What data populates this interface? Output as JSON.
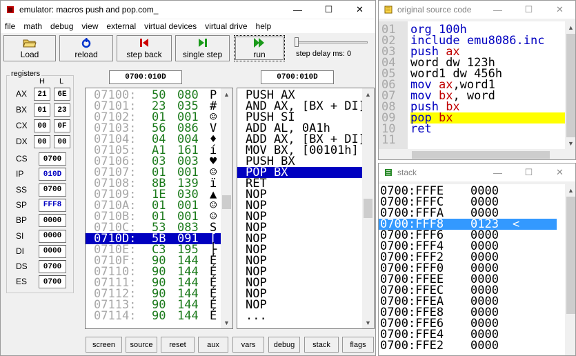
{
  "emulator": {
    "title": "emulator: macros push and pop.com_",
    "menu": [
      "file",
      "math",
      "debug",
      "view",
      "external",
      "virtual devices",
      "virtual drive",
      "help"
    ],
    "toolbar": {
      "load": "Load",
      "reload": "reload",
      "step_back": "step back",
      "single_step": "single step",
      "run": "run",
      "step_delay": "step delay ms: 0"
    },
    "registers_label": "registers",
    "col_h": "H",
    "col_l": "L",
    "gp": [
      {
        "name": "AX",
        "h": "21",
        "l": "6E"
      },
      {
        "name": "BX",
        "h": "01",
        "l": "23"
      },
      {
        "name": "CX",
        "h": "00",
        "l": "0F"
      },
      {
        "name": "DX",
        "h": "00",
        "l": "00"
      }
    ],
    "seg": [
      {
        "name": "CS",
        "value": "0700",
        "highlight": false
      },
      {
        "name": "IP",
        "value": "010D",
        "highlight": true
      },
      {
        "name": "SS",
        "value": "0700",
        "highlight": false
      },
      {
        "name": "SP",
        "value": "FFF8",
        "highlight": true
      },
      {
        "name": "BP",
        "value": "0000",
        "highlight": false
      },
      {
        "name": "SI",
        "value": "0000",
        "highlight": false
      },
      {
        "name": "DI",
        "value": "0000",
        "highlight": false
      },
      {
        "name": "DS",
        "value": "0700",
        "highlight": false
      },
      {
        "name": "ES",
        "value": "0700",
        "highlight": false
      }
    ],
    "mem_address": "0700:010D",
    "dis_address": "0700:010D",
    "memory": [
      {
        "addr": "07100:",
        "hex": "50",
        "dec": "080",
        "ch": "P"
      },
      {
        "addr": "07101:",
        "hex": "23",
        "dec": "035",
        "ch": "#"
      },
      {
        "addr": "07102:",
        "hex": "01",
        "dec": "001",
        "ch": "☺"
      },
      {
        "addr": "07103:",
        "hex": "56",
        "dec": "086",
        "ch": "V"
      },
      {
        "addr": "07104:",
        "hex": "04",
        "dec": "004",
        "ch": "♦"
      },
      {
        "addr": "07105:",
        "hex": "A1",
        "dec": "161",
        "ch": "í"
      },
      {
        "addr": "07106:",
        "hex": "03",
        "dec": "003",
        "ch": "♥"
      },
      {
        "addr": "07107:",
        "hex": "01",
        "dec": "001",
        "ch": "☺"
      },
      {
        "addr": "07108:",
        "hex": "8B",
        "dec": "139",
        "ch": "ï"
      },
      {
        "addr": "07109:",
        "hex": "1E",
        "dec": "030",
        "ch": "▲"
      },
      {
        "addr": "0710A:",
        "hex": "01",
        "dec": "001",
        "ch": "☺"
      },
      {
        "addr": "0710B:",
        "hex": "01",
        "dec": "001",
        "ch": "☺"
      },
      {
        "addr": "0710C:",
        "hex": "53",
        "dec": "083",
        "ch": "S"
      },
      {
        "addr": "0710D:",
        "hex": "5B",
        "dec": "091",
        "ch": "["
      },
      {
        "addr": "0710E:",
        "hex": "C3",
        "dec": "195",
        "ch": "├"
      },
      {
        "addr": "0710F:",
        "hex": "90",
        "dec": "144",
        "ch": "É"
      },
      {
        "addr": "07110:",
        "hex": "90",
        "dec": "144",
        "ch": "É"
      },
      {
        "addr": "07111:",
        "hex": "90",
        "dec": "144",
        "ch": "É"
      },
      {
        "addr": "07112:",
        "hex": "90",
        "dec": "144",
        "ch": "É"
      },
      {
        "addr": "07113:",
        "hex": "90",
        "dec": "144",
        "ch": "É"
      },
      {
        "addr": "07114:",
        "hex": "90",
        "dec": "144",
        "ch": "É"
      }
    ],
    "memory_selected_index": 13,
    "disasm": [
      "PUSH AX",
      "AND AX, [BX + DI]",
      "PUSH SI",
      "ADD AL, 0A1h",
      "ADD AX, [BX + DI]",
      "MOV BX, [00101h]",
      "PUSH BX",
      "POP BX",
      "RET",
      "NOP",
      "NOP",
      "NOP",
      "NOP",
      "NOP",
      "NOP",
      "NOP",
      "NOP",
      "NOP",
      "NOP",
      "NOP",
      "..."
    ],
    "disasm_selected_index": 7,
    "bottom_buttons": [
      "screen",
      "source",
      "reset",
      "aux",
      "vars",
      "debug",
      "stack",
      "flags"
    ]
  },
  "source": {
    "title": "original source code",
    "lines": [
      {
        "num": "01",
        "parts": [
          {
            "t": "org 100h",
            "c": "kw"
          }
        ]
      },
      {
        "num": "02",
        "parts": [
          {
            "t": "include emu8086.inc",
            "c": "kw"
          }
        ]
      },
      {
        "num": "03",
        "parts": [
          {
            "t": "push ",
            "c": "kw"
          },
          {
            "t": "ax",
            "c": "reg"
          }
        ]
      },
      {
        "num": "04",
        "parts": [
          {
            "t": "word dw 123h",
            "c": "plain"
          }
        ]
      },
      {
        "num": "05",
        "parts": [
          {
            "t": "word1 dw 456h",
            "c": "plain"
          }
        ]
      },
      {
        "num": "06",
        "parts": [
          {
            "t": "mov ",
            "c": "kw"
          },
          {
            "t": "ax",
            "c": "reg"
          },
          {
            "t": ",word1",
            "c": "plain"
          }
        ]
      },
      {
        "num": "07",
        "parts": [
          {
            "t": "mov ",
            "c": "kw"
          },
          {
            "t": "bx",
            "c": "reg"
          },
          {
            "t": ", word",
            "c": "plain"
          }
        ]
      },
      {
        "num": "08",
        "parts": [
          {
            "t": "push ",
            "c": "kw"
          },
          {
            "t": "bx",
            "c": "reg"
          }
        ]
      },
      {
        "num": "09",
        "parts": [
          {
            "t": "pop ",
            "c": "kw"
          },
          {
            "t": "bx",
            "c": "reg"
          }
        ]
      },
      {
        "num": "10",
        "parts": [
          {
            "t": "ret",
            "c": "kw"
          }
        ]
      },
      {
        "num": "11",
        "parts": []
      }
    ],
    "highlight_index": 8
  },
  "stack": {
    "title": "stack",
    "rows": [
      {
        "addr": "0700:FFFE",
        "val": "0000",
        "mark": ""
      },
      {
        "addr": "0700:FFFC",
        "val": "0000",
        "mark": ""
      },
      {
        "addr": "0700:FFFA",
        "val": "0000",
        "mark": ""
      },
      {
        "addr": "0700:FFF8",
        "val": "0123",
        "mark": "<"
      },
      {
        "addr": "0700:FFF6",
        "val": "0000",
        "mark": ""
      },
      {
        "addr": "0700:FFF4",
        "val": "0000",
        "mark": ""
      },
      {
        "addr": "0700:FFF2",
        "val": "0000",
        "mark": ""
      },
      {
        "addr": "0700:FFF0",
        "val": "0000",
        "mark": ""
      },
      {
        "addr": "0700:FFEE",
        "val": "0000",
        "mark": ""
      },
      {
        "addr": "0700:FFEC",
        "val": "0000",
        "mark": ""
      },
      {
        "addr": "0700:FFEA",
        "val": "0000",
        "mark": ""
      },
      {
        "addr": "0700:FFE8",
        "val": "0000",
        "mark": ""
      },
      {
        "addr": "0700:FFE6",
        "val": "0000",
        "mark": ""
      },
      {
        "addr": "0700:FFE4",
        "val": "0000",
        "mark": ""
      },
      {
        "addr": "0700:FFE2",
        "val": "0000",
        "mark": ""
      }
    ],
    "highlight_index": 3
  },
  "colors": {
    "selection_blue": "#0000c0",
    "stack_highlight": "#3399ff",
    "source_highlight": "#ffff00",
    "memory_green": "#1b7a1b"
  }
}
